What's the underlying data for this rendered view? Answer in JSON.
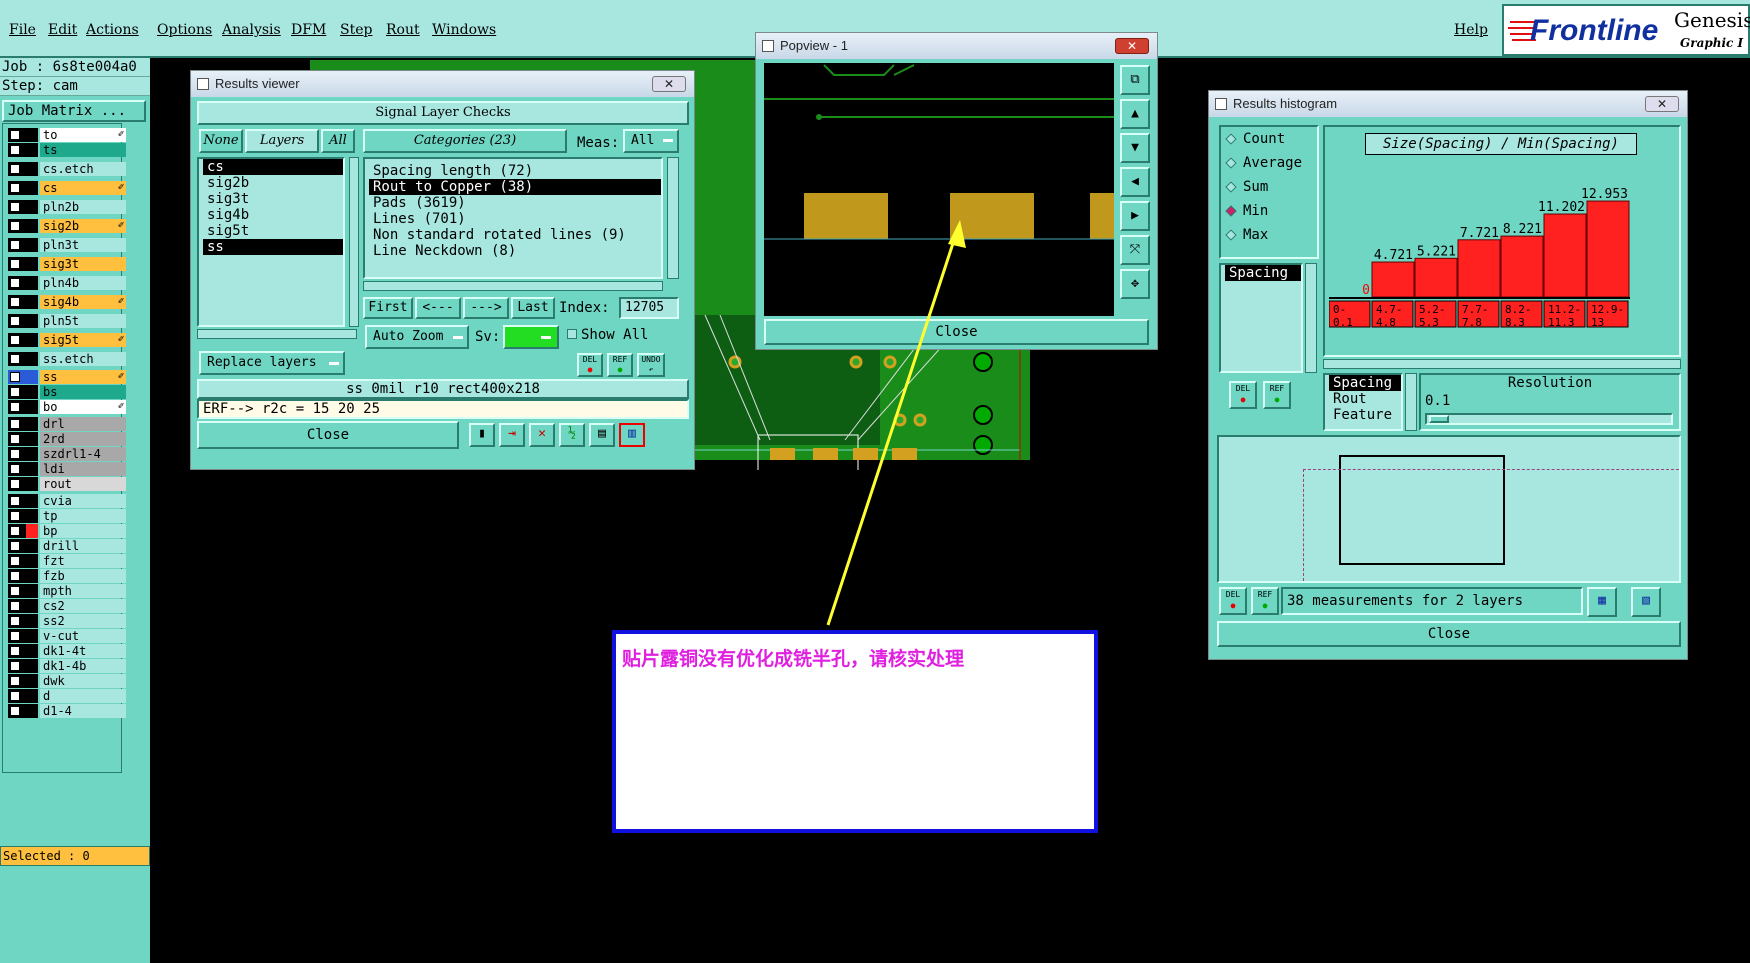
{
  "menubar": {
    "items": [
      "File",
      "Edit",
      "Actions",
      "Options",
      "Analysis",
      "DFM",
      "Step",
      "Rout",
      "Windows"
    ],
    "help": "Help",
    "brand": "Frontline",
    "product": "Genesis",
    "product_sub": "Graphic I"
  },
  "job": {
    "job_label": "Job : 6s8te004a0",
    "step_label": "Step: cam",
    "matrix_button": "Job Matrix ...",
    "selected": "Selected : 0"
  },
  "layers": [
    {
      "name": "to",
      "color": "#ffffff",
      "edit": true
    },
    {
      "name": "ts",
      "color": "#1fa98c"
    },
    {
      "name": "cs.etch",
      "color": "#a8e6e0"
    },
    {
      "name": "cs",
      "color": "#ffc040",
      "edit": true
    },
    {
      "name": "pln2b",
      "color": "#a8e6e0"
    },
    {
      "name": "sig2b",
      "color": "#ffc040",
      "edit": true
    },
    {
      "name": "pln3t",
      "color": "#a8e6e0"
    },
    {
      "name": "sig3t",
      "color": "#ffc040"
    },
    {
      "name": "pln4b",
      "color": "#a8e6e0"
    },
    {
      "name": "sig4b",
      "color": "#ffc040",
      "edit": true
    },
    {
      "name": "pln5t",
      "color": "#a8e6e0"
    },
    {
      "name": "sig5t",
      "color": "#ffc040",
      "edit": true
    },
    {
      "name": "ss.etch",
      "color": "#a8e6e0"
    },
    {
      "name": "ss",
      "color": "#ffc040",
      "edit": true,
      "active": true
    },
    {
      "name": "bs",
      "color": "#1fa98c"
    },
    {
      "name": "bo",
      "color": "#ffffff",
      "edit": true
    },
    {
      "name": "drl",
      "color": "#a8a8a8"
    },
    {
      "name": "2rd",
      "color": "#a8a8a8"
    },
    {
      "name": "szdrl1-4",
      "color": "#a8a8a8"
    },
    {
      "name": "ldi",
      "color": "#a8a8a8"
    },
    {
      "name": "rout",
      "color": "#d8d8d8"
    },
    {
      "name": "cvia",
      "color": "#a8e6e0"
    },
    {
      "name": "tp",
      "color": "#a8e6e0"
    },
    {
      "name": "bp",
      "color": "#a8e6e0",
      "marker": "#ff2020"
    },
    {
      "name": "drill",
      "color": "#a8e6e0"
    },
    {
      "name": "fzt",
      "color": "#a8e6e0"
    },
    {
      "name": "fzb",
      "color": "#a8e6e0"
    },
    {
      "name": "mpth",
      "color": "#a8e6e0"
    },
    {
      "name": "cs2",
      "color": "#a8e6e0"
    },
    {
      "name": "ss2",
      "color": "#a8e6e0"
    },
    {
      "name": "v-cut",
      "color": "#a8e6e0"
    },
    {
      "name": "dk1-4t",
      "color": "#a8e6e0"
    },
    {
      "name": "dk1-4b",
      "color": "#a8e6e0"
    },
    {
      "name": "dwk",
      "color": "#a8e6e0"
    },
    {
      "name": "d",
      "color": "#a8e6e0"
    },
    {
      "name": "d1-4",
      "color": "#a8e6e0"
    }
  ],
  "results_viewer": {
    "title": "Results viewer",
    "heading": "Signal Layer Checks",
    "tabs": {
      "none": "None",
      "layers": "Layers",
      "all": "All"
    },
    "layer_list": [
      "cs",
      "sig2b",
      "sig3t",
      "sig4b",
      "sig5t",
      "ss"
    ],
    "categories_label": "Categories (23)",
    "meas_label": "Meas:",
    "meas_value": "All",
    "categories": [
      "Spacing length (72)",
      "Rout to Copper (38)",
      "Pads (3619)",
      "Lines (701)",
      "Non standard rotated lines (9)",
      "Line Neckdown (8)"
    ],
    "nav": {
      "first": "First",
      "prev": "<---",
      "next": "--->",
      "last": "Last",
      "index_label": "Index:",
      "index_value": "12705"
    },
    "auto_zoom": "Auto Zoom",
    "sv_label": "Sv:",
    "show_all": "Show All",
    "replace_layers": "Replace layers",
    "btn_del": "DEL",
    "btn_ref": "REF",
    "btn_undo": "UNDO",
    "status": "ss 0mil  r10  rect400x218",
    "erf": "ERF--> r2c = 15 20 25",
    "close": "Close"
  },
  "popview": {
    "title": "Popview - 1",
    "close": "Close"
  },
  "histogram": {
    "title": "Results histogram",
    "modes": [
      "Count",
      "Average",
      "Sum",
      "Min",
      "Max"
    ],
    "selected_mode": "Min",
    "chart_title": "Size(Spacing) / Min(Spacing)",
    "measure_list": [
      "Spacing"
    ],
    "field_list": [
      "Spacing",
      "Rout",
      "Feature"
    ],
    "resolution_label": "Resolution",
    "resolution_value": "0.1",
    "btn_del": "DEL",
    "btn_ref": "REF",
    "summary": "38 measurements for 2 layers",
    "close": "Close"
  },
  "chart_data": {
    "type": "bar",
    "title": "Size(Spacing) / Min(Spacing)",
    "categories": [
      "0-\n0.1",
      "4.7-\n4.8",
      "5.2-\n5.3",
      "7.7-\n7.8",
      "8.2-\n8.3",
      "11.2-\n11.3",
      "12.9-\n13"
    ],
    "values": [
      0,
      4.721,
      5.221,
      7.721,
      8.221,
      11.202,
      12.953
    ],
    "labels": [
      "0",
      "4.721",
      "5.221",
      "7.721",
      "8.221",
      "11.202",
      "12.953"
    ],
    "ylim": [
      0,
      13.5
    ],
    "colors": {
      "bar": "#ff2020",
      "label_zero": "#ff0000"
    }
  },
  "note": {
    "text": "贴片露铜没有优化成铣半孔，请核实处理"
  }
}
